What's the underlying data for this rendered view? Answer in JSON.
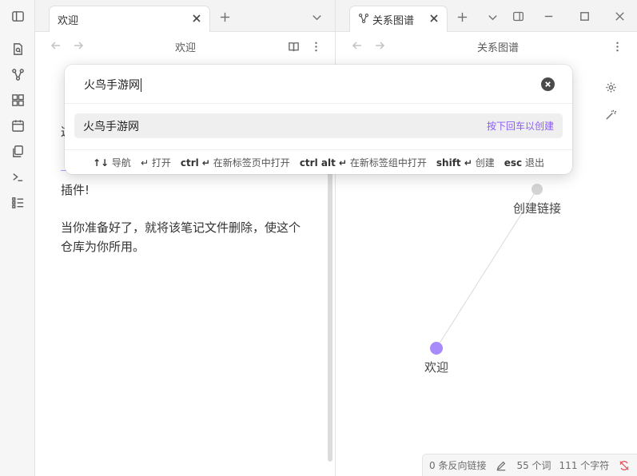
{
  "left_pane": {
    "tab_title": "欢迎",
    "header_title": "欢迎",
    "body_partial_1": "这",
    "body_partial_2": "插件!",
    "body_paragraph": "当你准备好了，就将该笔记文件删除，使这个仓库为你所用。"
  },
  "right_pane": {
    "tab_title": "关系图谱",
    "header_title": "关系图谱",
    "graph": {
      "nodes": [
        {
          "label": "创建链接",
          "color": "#d4d4d4"
        },
        {
          "label": "欢迎",
          "color": "#a78bfa"
        }
      ]
    }
  },
  "status_bar": {
    "backlinks": "0 条反向链接",
    "words": "55 个词",
    "chars": "111 个字符"
  },
  "modal": {
    "input_value": "火鸟手游网",
    "suggestion_title": "火鸟手游网",
    "suggestion_hint": "按下回车以创建",
    "instructions": [
      {
        "key": "↑↓",
        "label": "导航"
      },
      {
        "key": "↵",
        "label": "打开"
      },
      {
        "key": "ctrl ↵",
        "label": "在新标签页中打开"
      },
      {
        "key": "ctrl alt ↵",
        "label": "在新标签组中打开"
      },
      {
        "key": "shift ↵",
        "label": "创建"
      },
      {
        "key": "esc",
        "label": "退出"
      }
    ]
  },
  "colors": {
    "accent": "#8a5cf5",
    "node_active": "#a78bfa",
    "node_inactive": "#d4d4d4"
  }
}
